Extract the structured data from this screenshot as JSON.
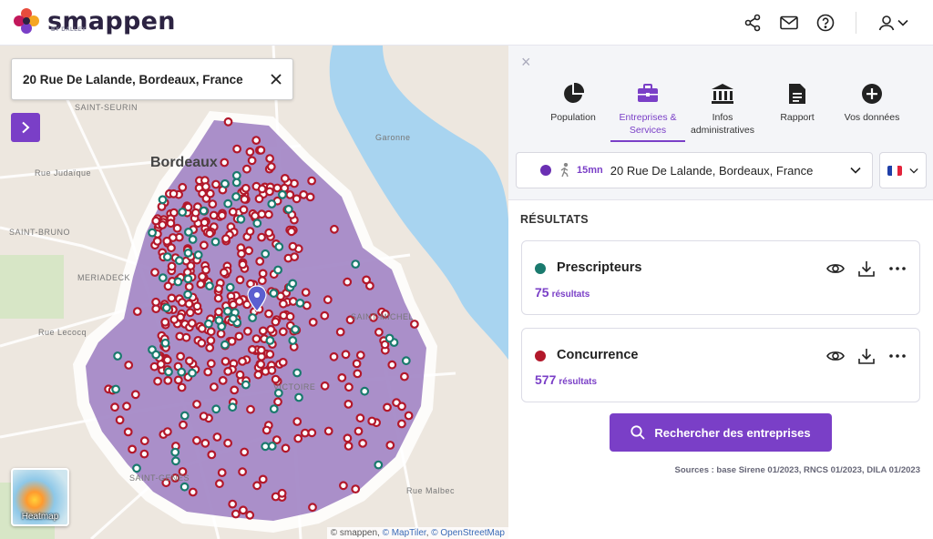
{
  "app": {
    "logo_text": "smappen",
    "logo_sub": "BY DALLEY",
    "brand_color": "#7a3fc7",
    "icons": [
      "share-icon",
      "mail-icon",
      "help-icon",
      "user-icon",
      "chevron-down-icon"
    ]
  },
  "map": {
    "search_value": "20 Rue De Lalande, Bordeaux, France",
    "labels": [
      "SAINT-SEURIN",
      "Bordeaux",
      "Rue Judaïque",
      "SAINT-BRUNO",
      "MERIADECK",
      "Rue Lecocq",
      "SAINT-MICHEL",
      "VICTOIRE",
      "SAINT-GENÈS",
      "Rue Malbec",
      "Garonne"
    ],
    "heatmap_label": "Heatmap",
    "attribution_prefix": "© smappen, ",
    "attribution_maptiler": "© MapTiler",
    "attribution_sep": ", ",
    "attribution_osm": "© OpenStreetMap"
  },
  "panel": {
    "close": "×",
    "tabs": [
      {
        "label": "Population",
        "icon": "pie-chart-icon"
      },
      {
        "label": "Entreprises & Services",
        "icon": "briefcase-icon"
      },
      {
        "label": "Infos administratives",
        "icon": "bank-icon"
      },
      {
        "label": "Rapport",
        "icon": "document-icon"
      },
      {
        "label": "Vos données",
        "icon": "plus-circle-icon"
      }
    ],
    "active_tab": 1,
    "isochrone": {
      "minutes": "15mn",
      "address": "20 Rue De Lalande, Bordeaux, France",
      "color": "#6a2fb3",
      "icon": "walk-icon"
    },
    "results_title": "RÉSULTATS",
    "results": [
      {
        "name": "Prescripteurs",
        "count": "75",
        "unit": "résultats",
        "color": "#1a7a6e"
      },
      {
        "name": "Concurrence",
        "count": "577",
        "unit": "résultats",
        "color": "#b2182b"
      }
    ],
    "search_button": "Rechercher des entreprises",
    "sources": "Sources : base Sirene 01/2023, RNCS 01/2023, DILA 01/2023"
  }
}
